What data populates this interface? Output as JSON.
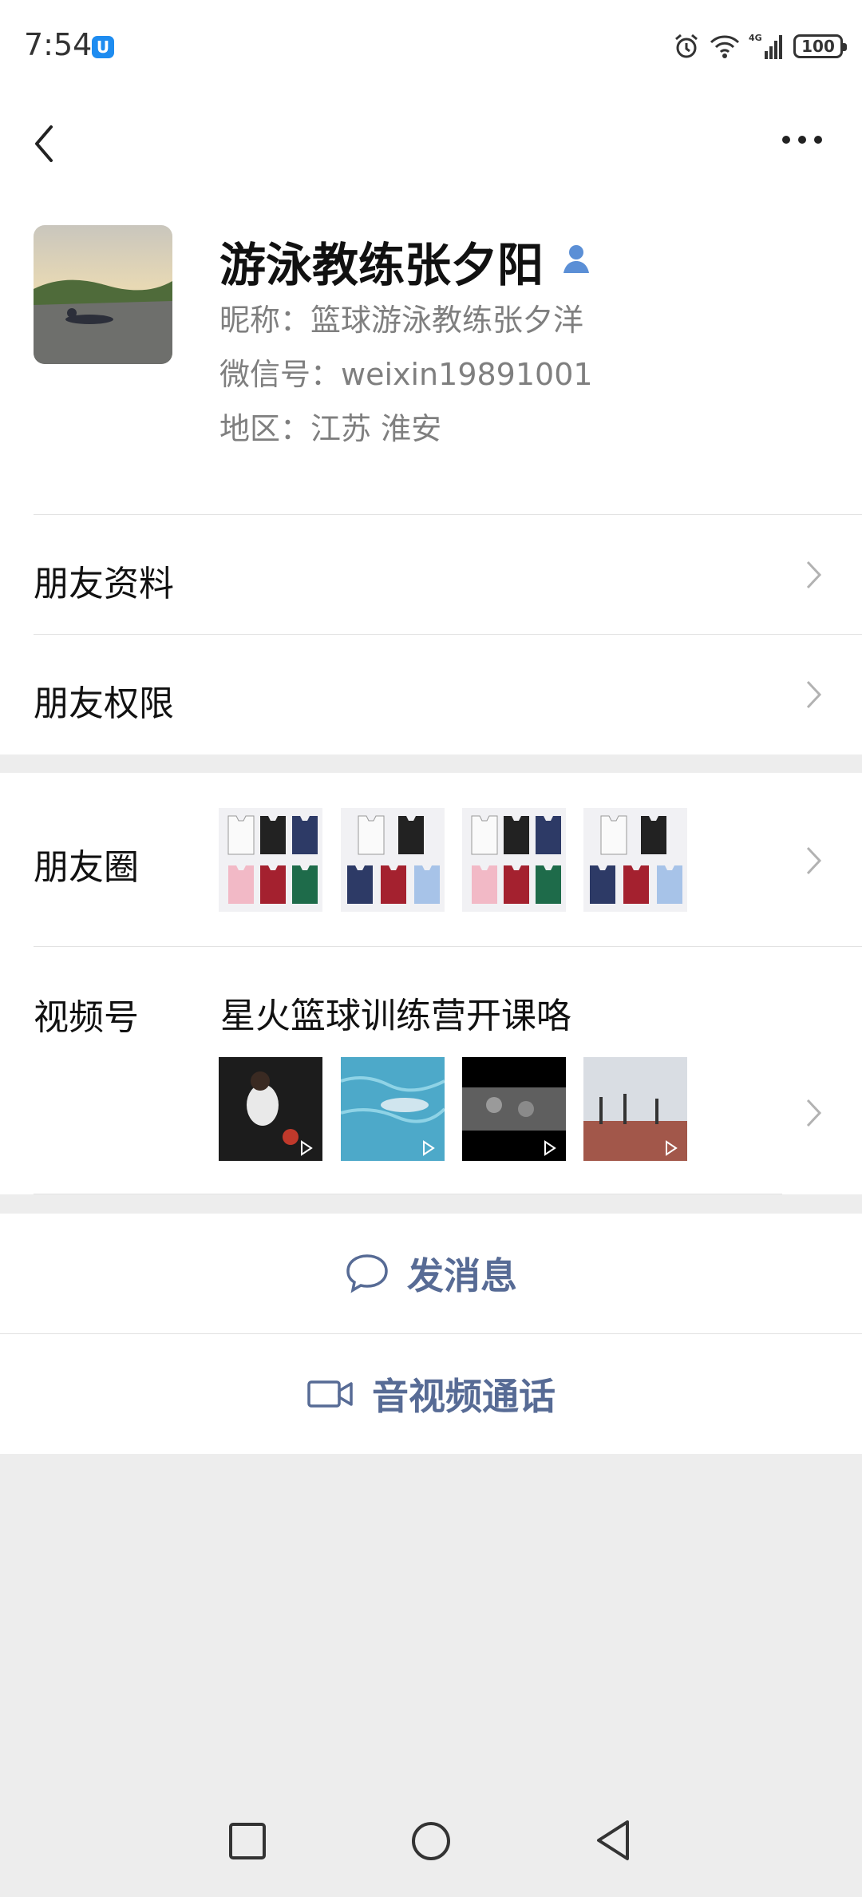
{
  "status_bar": {
    "time": "7:54",
    "app_badge": "U",
    "battery": "100",
    "network": "4G"
  },
  "profile": {
    "name": "游泳教练张夕阳",
    "nickname": "昵称：篮球游泳教练张夕洋",
    "wechat_id": "微信号：weixin19891001",
    "region": "地区：江苏  淮安"
  },
  "menu": {
    "friend_info": "朋友资料",
    "friend_permissions": "朋友权限",
    "moments": "朋友圈",
    "channels": "视频号",
    "channels_title": "星火篮球训练营开课咯"
  },
  "actions": {
    "send_message": "发消息",
    "video_call": "音视频通话"
  },
  "colors": {
    "accent": "#576b95",
    "verify": "#5b8fd6",
    "background": "#ededed"
  }
}
